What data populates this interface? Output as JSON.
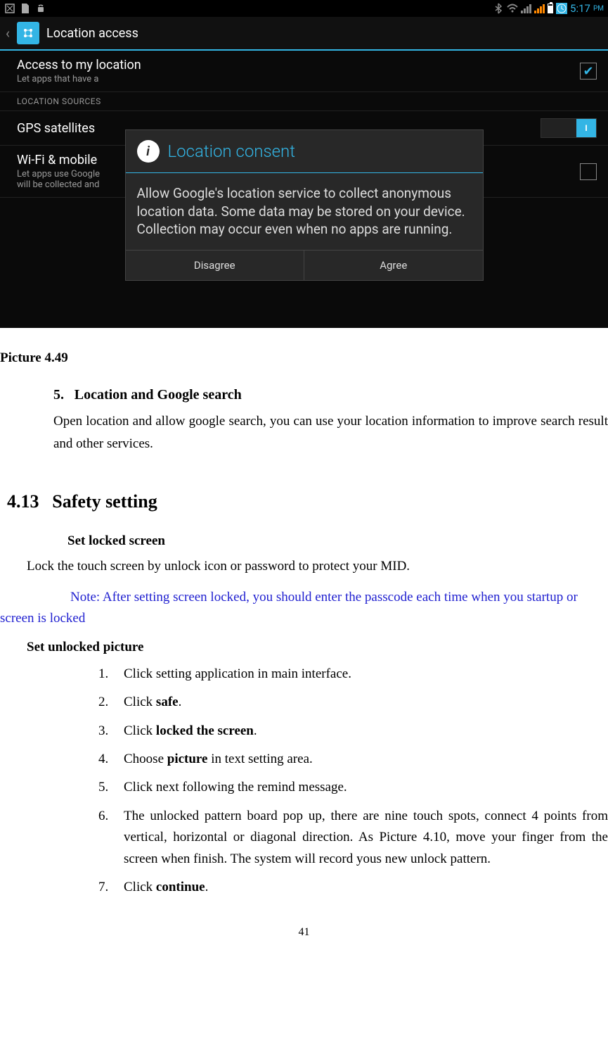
{
  "status": {
    "time": "5:17",
    "ampm": "PM"
  },
  "appbar": {
    "title": "Location access"
  },
  "settings": {
    "access": {
      "title": "Access to my location",
      "subtitle": "Let apps that have a"
    },
    "section_header": "LOCATION SOURCES",
    "gps": {
      "title": "GPS satellites"
    },
    "wifi": {
      "title": "Wi-Fi & mobile",
      "subtitle": "Let apps use Google                                                                                                                                                    ata\nwill be collected and"
    },
    "toggle_on": "I"
  },
  "dialog": {
    "title": "Location consent",
    "body": "Allow Google's location service to collect anonymous location data. Some data may be stored on your device. Collection may occur even when no apps are running.",
    "disagree": "Disagree",
    "agree": "Agree"
  },
  "caption": "Picture 4.49",
  "sec5": {
    "num": "5.",
    "title": "Location and Google search",
    "body": "Open location and allow google search, you can use your location information to improve search result and other services."
  },
  "h2": {
    "num": "4.13",
    "title": "Safety setting"
  },
  "sub1": "Set locked screen",
  "para1": "Lock the touch screen by unlock icon or password to protect your MID.",
  "note": "Note: After setting screen locked, you should enter the passcode each time when you startup or screen is locked",
  "sub2": "Set unlocked picture",
  "steps": [
    {
      "n": "1.",
      "t_pre": "Click setting application in main interface.",
      "b": ""
    },
    {
      "n": "2.",
      "t_pre": "Click ",
      "b": "safe",
      "t_post": "."
    },
    {
      "n": "3.",
      "t_pre": "Click ",
      "b": "locked the screen",
      "t_post": "."
    },
    {
      "n": "4.",
      "t_pre": "Choose ",
      "b": "picture",
      "t_post": " in text setting area."
    },
    {
      "n": "5.",
      "t_pre": "Click next following the remind message.",
      "b": ""
    },
    {
      "n": "6.",
      "t_pre": "The unlocked pattern board pop up, there are nine touch spots, connect 4 points from vertical, horizontal or diagonal direction. As Picture 4.10, move your finger from the screen when finish. The system will record yous new unlock pattern.",
      "b": ""
    },
    {
      "n": "7.",
      "t_pre": "Click ",
      "b": "continue",
      "t_post": "."
    }
  ],
  "pagenum": "41"
}
